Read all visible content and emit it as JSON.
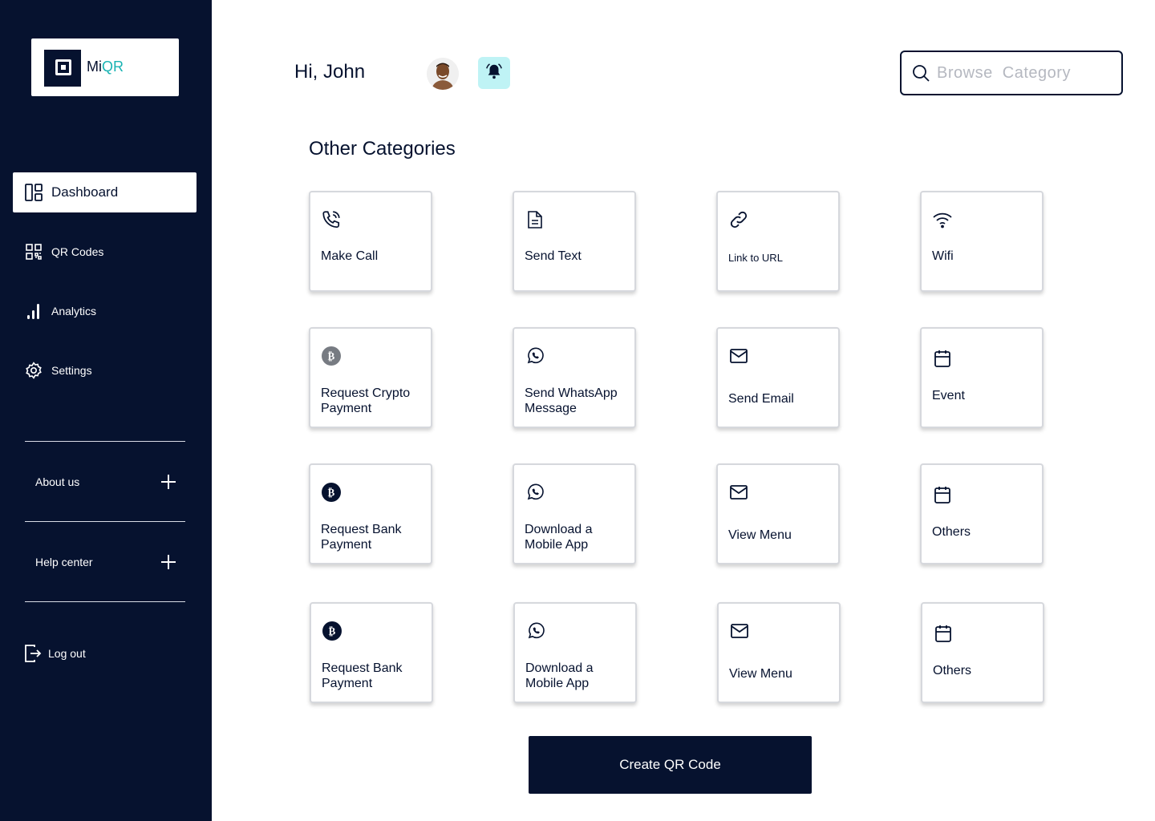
{
  "brand": {
    "name_prefix": "Mi",
    "name_suffix": "QR",
    "accent": "#19b3b3",
    "dark": "#06122f"
  },
  "sidebar": {
    "items": [
      {
        "label": "Dashboard",
        "icon": "dashboard-icon",
        "active": true
      },
      {
        "label": "QR Codes",
        "icon": "qr-code-icon"
      },
      {
        "label": "Analytics",
        "icon": "bar-chart-icon"
      },
      {
        "label": "Settings",
        "icon": "gear-icon"
      }
    ],
    "accordion": [
      {
        "label": "About us",
        "icon": "plus-icon"
      },
      {
        "label": "Help center",
        "icon": "plus-icon"
      }
    ],
    "logout_label": "Log out"
  },
  "header": {
    "greeting": "Hi, John",
    "search_placeholder": "Browse  Category",
    "bell_bg": "#bff3f5"
  },
  "main": {
    "section_title": "Other Categories",
    "cards": [
      {
        "label": "Make Call",
        "icon": "phone-icon"
      },
      {
        "label": "Send Text",
        "icon": "document-icon"
      },
      {
        "label": "Link to URL",
        "icon": "link-icon"
      },
      {
        "label": "Wifi",
        "icon": "wifi-icon"
      },
      {
        "label": "Request Crypto Payment",
        "icon": "bitcoin-icon"
      },
      {
        "label": "Send WhatsApp Message",
        "icon": "whatsapp-icon"
      },
      {
        "label": "Send Email",
        "icon": "mail-icon"
      },
      {
        "label": "Event",
        "icon": "calendar-icon"
      },
      {
        "label": "Request Bank Payment",
        "icon": "bitcoin-icon"
      },
      {
        "label": "Download a Mobile App",
        "icon": "whatsapp-icon"
      },
      {
        "label": "View Menu",
        "icon": "mail-icon"
      },
      {
        "label": "Others",
        "icon": "calendar-icon"
      },
      {
        "label": "Request Bank Payment",
        "icon": "bitcoin-icon"
      },
      {
        "label": "Download a Mobile App",
        "icon": "whatsapp-icon"
      },
      {
        "label": "View Menu",
        "icon": "mail-icon"
      },
      {
        "label": "Others",
        "icon": "calendar-icon"
      }
    ],
    "cta_label": "Create QR Code"
  }
}
